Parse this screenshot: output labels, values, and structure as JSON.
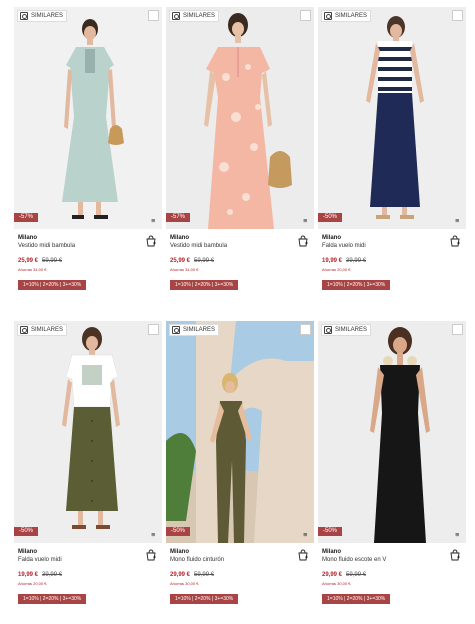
{
  "similar_label": "SIMILARES",
  "products": [
    {
      "discount": "-57%",
      "brand": "Milano",
      "name": "Vestido midi bambula",
      "price": "25,99 €",
      "old_price": "59,99 €",
      "savings": "Ahorras 34,00 €",
      "promo": "1=10% | 2=20% | 3+=30%",
      "illustration": "mint dress"
    },
    {
      "discount": "-57%",
      "brand": "Milano",
      "name": "Vestido midi bambula",
      "price": "25,99 €",
      "old_price": "59,99 €",
      "savings": "Ahorras 34,00 €",
      "promo": "1=10% | 2=20% | 3+=30%",
      "illustration": "coral floral dress"
    },
    {
      "discount": "-50%",
      "brand": "Milano",
      "name": "Falda vuelo midi",
      "price": "19,99 €",
      "old_price": "39,99 €",
      "savings": "Ahorras 20,00 €",
      "promo": "1=10% | 2=20% | 3+=30%",
      "illustration": "navy skirt"
    },
    {
      "discount": "-50%",
      "brand": "Milano",
      "name": "Falda vuelo midi",
      "price": "19,99 €",
      "old_price": "39,99 €",
      "savings": "Ahorras 20,00 €",
      "promo": "1=10% | 2=20% | 3+=30%",
      "illustration": "olive skirt"
    },
    {
      "discount": "-50%",
      "brand": "Milano",
      "name": "Mono fluido cinturón",
      "price": "29,99 €",
      "old_price": "59,99 €",
      "savings": "Ahorras 30,00 €",
      "promo": "1=10% | 2=20% | 3+=30%",
      "illustration": "olive jumpsuit"
    },
    {
      "discount": "-50%",
      "brand": "Milano",
      "name": "Mono fluido escote en V",
      "price": "29,99 €",
      "old_price": "59,99 €",
      "savings": "Ahorras 30,00 €",
      "promo": "1=10% | 2=20% | 3+=30%",
      "illustration": "black jumpsuit"
    }
  ],
  "colors": {
    "accent": "#a94444",
    "price": "#b3262e"
  }
}
